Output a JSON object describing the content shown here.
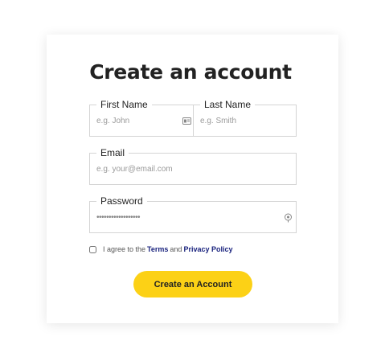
{
  "form": {
    "title": "Create an account",
    "first_name": {
      "label": "First Name",
      "placeholder": "e.g. John",
      "icon": "id-card-icon"
    },
    "last_name": {
      "label": "Last Name",
      "placeholder": "e.g. Smith"
    },
    "email": {
      "label": "Email",
      "placeholder": "e.g. your@email.com"
    },
    "password": {
      "label": "Password",
      "value": "••••••••••••••••••",
      "icon": "reveal-password-icon"
    },
    "terms": {
      "prefix": "I agree to the",
      "terms_link": "Terms",
      "conjunction": "and",
      "privacy_link": "Privacy Policy"
    },
    "submit_label": "Create an Account"
  },
  "colors": {
    "accent": "#fcd116",
    "link": "#1a237e",
    "border": "#d4d4d4",
    "text": "#222222"
  }
}
